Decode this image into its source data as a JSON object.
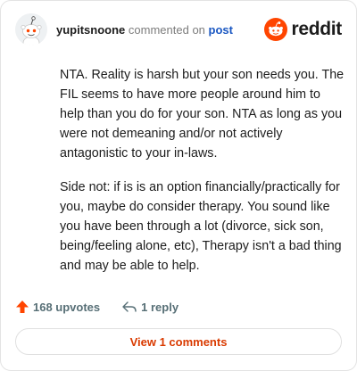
{
  "header": {
    "username": "yupitsnoone",
    "action_text": "commented on",
    "post_link": "post",
    "logo_text": "reddit",
    "brand_color": "#ff4500"
  },
  "comment": {
    "paragraphs": [
      "NTA. Reality is harsh but your son needs you. The FIL seems to have more people around him to help than you do for your son. NTA as long as you were not demeaning and/or not actively antagonistic to your in-laws.",
      "Side not: if is is an option financially/practically for you, maybe do consider therapy. You sound like you have been through a lot (divorce, sick son, being/feeling alone, etc), Therapy isn't a bad thing and may be able to help."
    ]
  },
  "actions": {
    "upvote_icon": "upvote-arrow-icon",
    "upvotes_label": "168 upvotes",
    "upvote_color": "#ff4500",
    "reply_icon": "reply-arrow-icon",
    "reply_label": "1 reply"
  },
  "footer": {
    "view_comments_label": "View 1 comments",
    "link_color": "#d93a00"
  }
}
